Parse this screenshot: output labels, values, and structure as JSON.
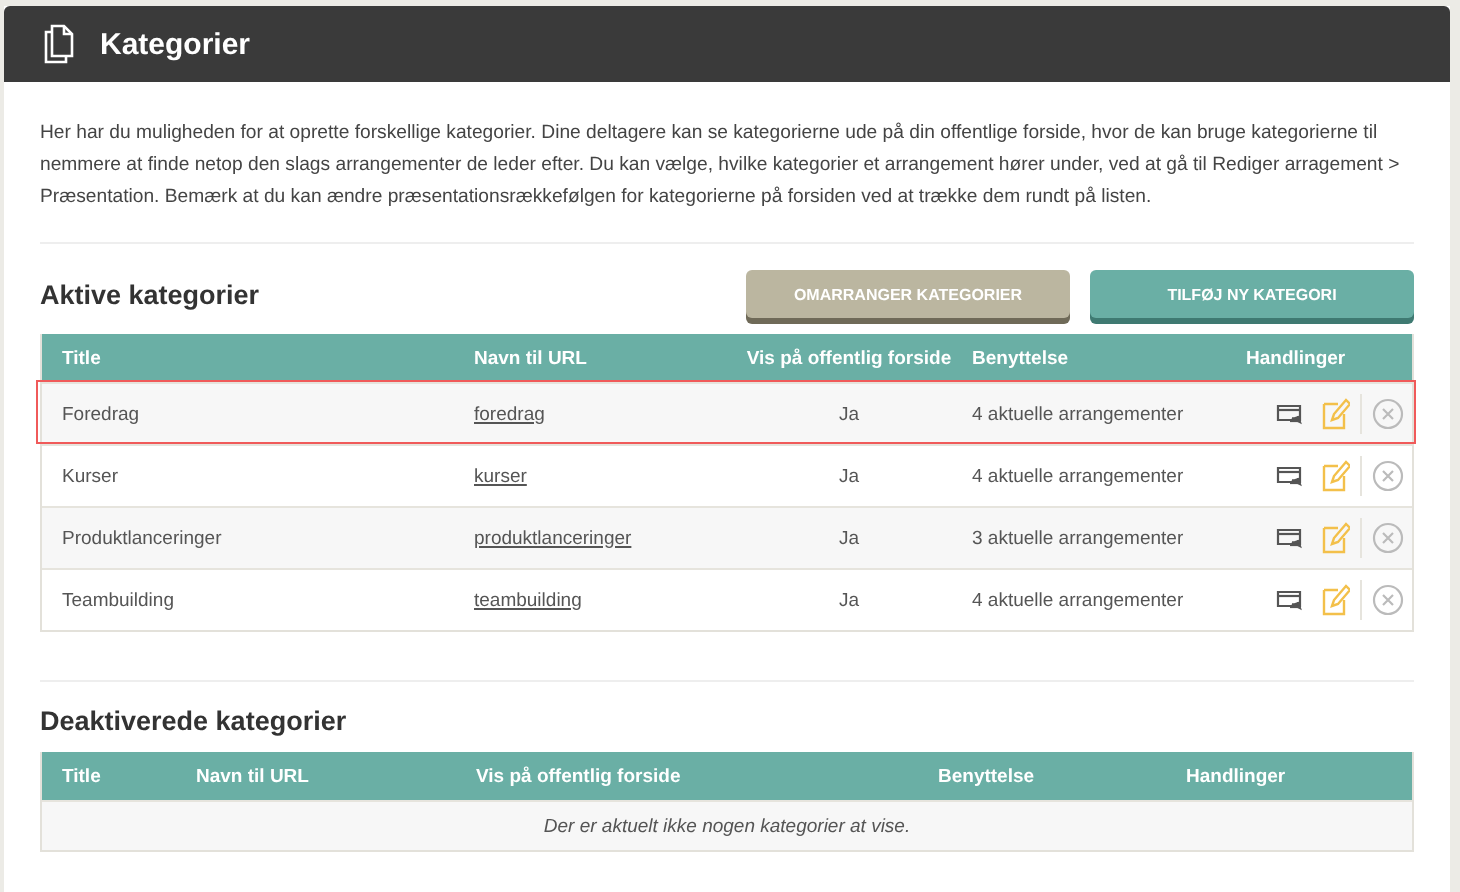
{
  "header": {
    "title": "Kategorier"
  },
  "intro": "Her har du muligheden for at oprette forskellige kategorier. Dine deltagere kan se kategorierne ude på din offentlige forside, hvor de kan bruge kategorierne til nemmere at finde netop den slags arrangementer de leder efter. Du kan vælge, hvilke kategorier et arrangement hører under, ved at gå til Rediger arragement > Præsentation. Bemærk at du kan ændre præsentationsrækkefølgen for kategorierne på forsiden ved at trække dem rundt på listen.",
  "active": {
    "heading": "Aktive kategorier",
    "buttons": [
      {
        "label": "OMARRANGER KATEGORIER",
        "kind": "secondary"
      },
      {
        "label": "TILFØJ NY KATEGORI",
        "kind": "primary"
      }
    ],
    "columns": [
      "Title",
      "Navn til URL",
      "Vis på offentlig forside",
      "Benyttelse",
      "Handlinger"
    ],
    "rows": [
      {
        "title": "Foredrag",
        "url": "foredrag",
        "visible": "Ja",
        "usage": "4 aktuelle arrangementer",
        "highlighted": true
      },
      {
        "title": "Kurser",
        "url": "kurser",
        "visible": "Ja",
        "usage": "4 aktuelle arrangementer",
        "highlighted": false
      },
      {
        "title": "Produktlanceringer",
        "url": "produktlanceringer",
        "visible": "Ja",
        "usage": "3 aktuelle arrangementer",
        "highlighted": false
      },
      {
        "title": "Teambuilding",
        "url": "teambuilding",
        "visible": "Ja",
        "usage": "4 aktuelle arrangementer",
        "highlighted": false
      }
    ]
  },
  "inactive": {
    "heading": "Deaktiverede kategorier",
    "columns": [
      "Title",
      "Navn til URL",
      "Vis på offentlig forside",
      "Benyttelse",
      "Handlinger"
    ],
    "empty": "Der er aktuelt ikke nogen kategorier at vise."
  }
}
